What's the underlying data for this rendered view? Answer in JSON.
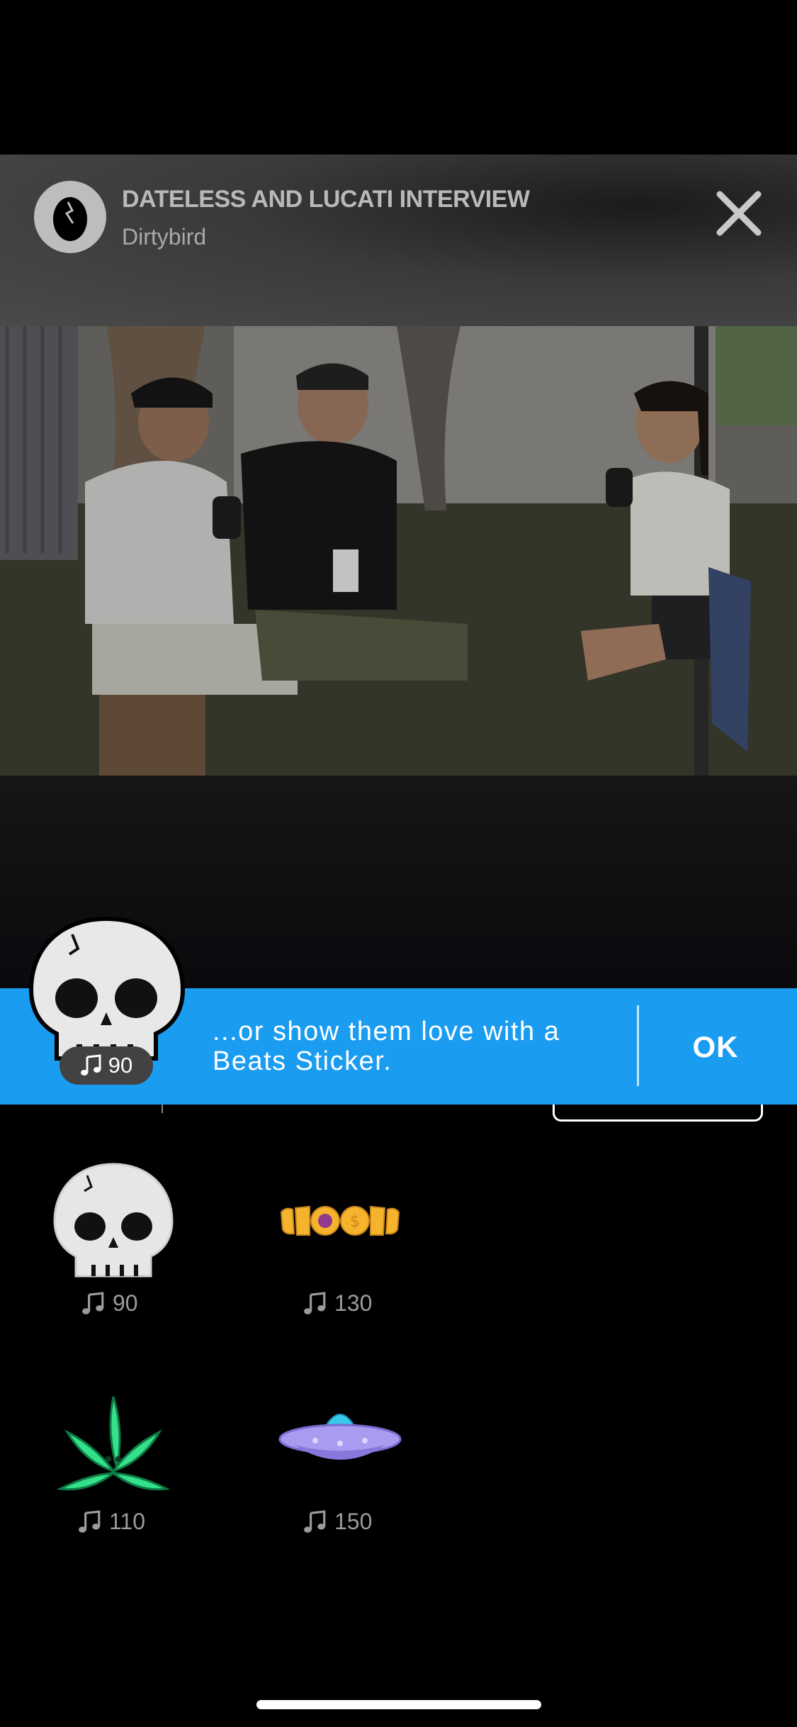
{
  "header": {
    "title": "DATELESS AND LUCATI INTERVIEW",
    "channel": "Dirtybird",
    "avatar_icon": "egg-logo-icon",
    "close_icon": "close-icon"
  },
  "banner": {
    "message_line1": "...or show them love with a",
    "message_line2": "Beats Sticker.",
    "ok_label": "OK",
    "featured_sticker": {
      "icon": "skull-sticker-icon",
      "price": "90"
    }
  },
  "stickers": [
    {
      "icon": "skull-sticker-icon",
      "price": "90"
    },
    {
      "icon": "gold-grill-sticker-icon",
      "price": "130"
    },
    {
      "icon": "leaf-sticker-icon",
      "price": "110"
    },
    {
      "icon": "ufo-sticker-icon",
      "price": "150"
    }
  ],
  "colors": {
    "banner_blue": "#1a9cf0",
    "price_gray": "#9b9b9b",
    "leaf_green": "#35e08a",
    "ufo_purple": "#a99cf0"
  }
}
